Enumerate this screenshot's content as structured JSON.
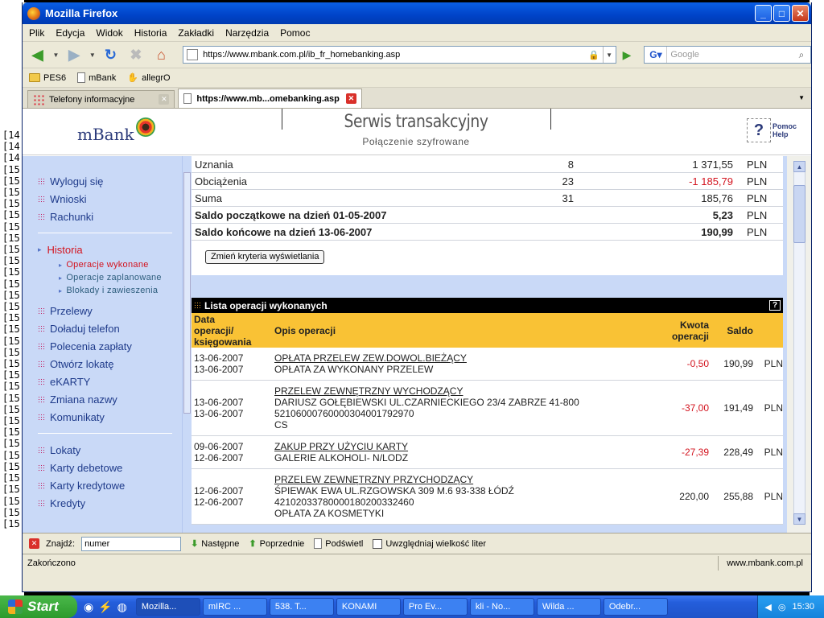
{
  "window": {
    "title": "Mozilla Firefox"
  },
  "menu": [
    "Plik",
    "Edycja",
    "Widok",
    "Historia",
    "Zakładki",
    "Narzędzia",
    "Pomoc"
  ],
  "url": "https://www.mbank.com.pl/ib_fr_homebanking.asp",
  "search_placeholder": "Google",
  "bookmarks": [
    "PES6",
    "mBank",
    "allegrO"
  ],
  "tabs": [
    {
      "label": "Telefony informacyjne",
      "active": false
    },
    {
      "label": "https://www.mb...omebanking.asp",
      "active": true
    }
  ],
  "bg_lines": [
    "[14",
    "[14",
    "[14",
    "[15",
    "[15",
    "[15",
    "[15",
    "[15",
    "[15",
    "[15",
    "[15",
    "[15",
    "[15",
    "[15",
    "[15",
    "[15",
    "[15",
    "[15",
    "[15",
    "[15",
    "[15",
    "[15",
    "[15",
    "[15",
    "[15",
    "[15",
    "[15",
    "[15",
    "[15",
    "[15",
    "[15",
    "[15",
    "[15",
    "[15",
    "[15"
  ],
  "header": {
    "logo": "mBank",
    "title": "Serwis transakcyjny",
    "subtitle": "Połączenie szyfrowane",
    "help_line1": "Pomoc",
    "help_line2": "Help"
  },
  "nav": {
    "logout": "Wyloguj się",
    "requests": "Wnioski",
    "accounts": "Rachunki",
    "history": "Historia",
    "sub_done": "Operacje wykonane",
    "sub_planned": "Operacje zaplanowane",
    "sub_blocks": "Blokady i zawieszenia",
    "transfers": "Przelewy",
    "topup": "Doładuj telefon",
    "direct_debit": "Polecenia zapłaty",
    "open_deposit": "Otwórz lokatę",
    "ekarty": "eKARTY",
    "rename": "Zmiana nazwy",
    "messages": "Komunikaty",
    "deposits": "Lokaty",
    "debit_cards": "Karty debetowe",
    "credit_cards": "Karty kredytowe",
    "loans": "Kredyty"
  },
  "summary": {
    "rows": [
      {
        "label": "Uznania",
        "count": "8",
        "amount": "1 371,55",
        "cur": "PLN"
      },
      {
        "label": "Obciążenia",
        "count": "23",
        "amount": "-1 185,79",
        "cur": "PLN"
      },
      {
        "label": "Suma",
        "count": "31",
        "amount": "185,76",
        "cur": "PLN"
      }
    ],
    "start_label": "Saldo początkowe na dzień 01-05-2007",
    "start_amount": "5,23",
    "end_label": "Saldo końcowe na dzień 13-06-2007",
    "end_amount": "190,99",
    "cur": "PLN",
    "change_button": "Zmień kryteria wyświetlania"
  },
  "ops": {
    "title": "Lista operacji wykonanych",
    "help": "?",
    "col_date_1": "Data",
    "col_date_2": "operacji/",
    "col_date_3": "księgowania",
    "col_desc": "Opis operacji",
    "col_amount_1": "Kwota",
    "col_amount_2": "operacji",
    "col_balance": "Saldo",
    "rows": [
      {
        "date1": "13-06-2007",
        "date2": "13-06-2007",
        "title": "OPŁATA PRZELEW ZEW.DOWOL.BIEŻĄCY",
        "lines": [
          "OPŁATA ZA WYKONANY PRZELEW"
        ],
        "amount": "-0,50",
        "balance": "190,99",
        "cur": "PLN"
      },
      {
        "date1": "13-06-2007",
        "date2": "13-06-2007",
        "title": "PRZELEW ZEWNĘTRZNY WYCHODZĄCY",
        "lines": [
          "DARIUSZ GOŁĘBIEWSKI UL.CZARNIECKIEGO 23/4 ZABRZE 41-800",
          "52106000760000304001792970",
          "CS"
        ],
        "amount": "-37,00",
        "balance": "191,49",
        "cur": "PLN"
      },
      {
        "date1": "09-06-2007",
        "date2": "12-06-2007",
        "title": "ZAKUP PRZY UŻYCIU KARTY",
        "lines": [
          "GALERIE ALKOHOLI- N/LODZ"
        ],
        "amount": "-27,39",
        "balance": "228,49",
        "cur": "PLN"
      },
      {
        "date1": "12-06-2007",
        "date2": "12-06-2007",
        "title": "PRZELEW ZEWNĘTRZNY PRZYCHODZĄCY",
        "lines": [
          "ŚPIEWAK EWA UL.RZGOWSKA 309 M.6 93-338 ŁÓDŹ",
          "42102033780000180200332460",
          "OPŁATA ZA KOSMETYKI"
        ],
        "amount": "220,00",
        "balance": "255,88",
        "cur": "PLN"
      }
    ]
  },
  "find": {
    "label": "Znajdź:",
    "value": "numer",
    "next": "Następne",
    "prev": "Poprzednie",
    "highlight": "Podświetl",
    "match_case": "Uwzględniaj wielkość liter"
  },
  "status": {
    "left": "Zakończono",
    "right": "www.mbank.com.pl"
  },
  "taskbar": {
    "start": "Start",
    "items": [
      "Mozilla...",
      "mIRC ...",
      "538. T...",
      "KONAMI",
      "Pro Ev...",
      "kli - No...",
      "Wilda ...",
      "Odebr..."
    ],
    "clock": "15:30"
  }
}
